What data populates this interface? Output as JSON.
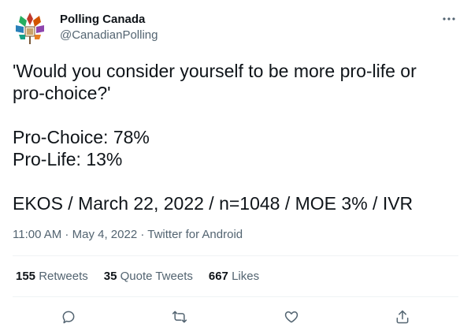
{
  "author": {
    "name": "Polling Canada",
    "handle": "@CanadianPolling",
    "avatar_icon": "maple-leaf-logo-icon"
  },
  "tweet": {
    "text": "'Would you consider yourself to be more pro-life or pro-choice?'\n\nPro-Choice: 78%\nPro-Life: 13%\n\nEKOS / March 22, 2022 / n=1048 / MOE 3% / IVR"
  },
  "meta": {
    "time": "11:00 AM",
    "sep1": " · ",
    "date": "May 4, 2022",
    "sep2": " · ",
    "source": "Twitter for Android"
  },
  "stats": {
    "retweets_count": "155",
    "retweets_label": "Retweets",
    "quotes_count": "35",
    "quotes_label": "Quote Tweets",
    "likes_count": "667",
    "likes_label": "Likes"
  },
  "actions": {
    "reply_icon": "reply-icon",
    "retweet_icon": "retweet-icon",
    "like_icon": "heart-icon",
    "share_icon": "share-icon",
    "more_icon": "more-dots-icon"
  },
  "colors": {
    "text": "#0f1419",
    "secondary": "#536471",
    "divider": "#eff3f4"
  }
}
